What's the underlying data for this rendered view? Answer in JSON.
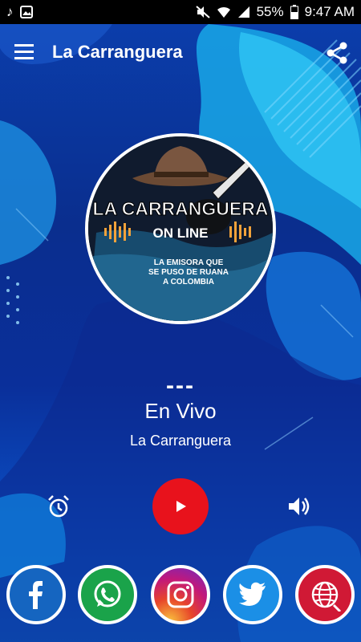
{
  "status_bar": {
    "battery_percent": "55%",
    "time": "9:47 AM"
  },
  "app_bar": {
    "title": "La Carranguera"
  },
  "logo": {
    "line1": "LA CARRANGUERA",
    "line2": "ON LINE",
    "tagline1": "LA EMISORA QUE",
    "tagline2": "SE PUSO DE RUANA",
    "tagline3": "A COLOMBIA"
  },
  "player": {
    "track_title": "---",
    "track_subtitle": "En Vivo",
    "station_name": "La Carranguera"
  },
  "social": [
    "facebook-icon",
    "whatsapp-icon",
    "instagram-icon",
    "twitter-icon",
    "web-icon"
  ],
  "colors": {
    "play_button": "#e8121c",
    "background": "#0a2e8e",
    "status_bar": "#000000"
  }
}
